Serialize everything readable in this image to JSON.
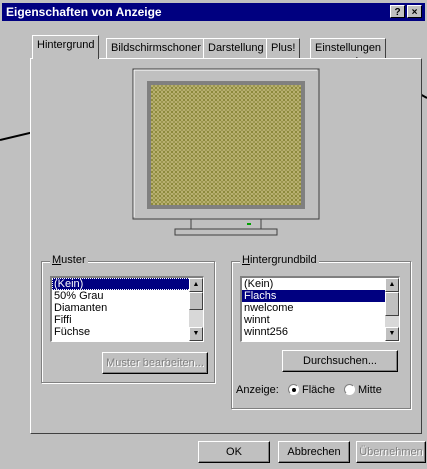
{
  "window": {
    "title": "Eigenschaften von Anzeige",
    "help_button": "?",
    "close_button": "×"
  },
  "tabs": [
    {
      "label": "Hintergrund",
      "active": true
    },
    {
      "label": "Bildschirmschoner",
      "active": false
    },
    {
      "label": "Darstellung",
      "active": false
    },
    {
      "label": "Plus!",
      "active": false
    },
    {
      "label": "Einstellungen",
      "active": false
    }
  ],
  "monitor": {
    "screen_pattern_color": "#a8a050",
    "icon": "monitor-preview"
  },
  "muster": {
    "label": "Muster",
    "items": [
      "(Kein)",
      "50% Grau",
      "Diamanten",
      "Fiffi",
      "Füchse"
    ],
    "selected": "(Kein)",
    "edit_button": "Muster bearbeiten..."
  },
  "hintergrundbild": {
    "label": "Hintergrundbild",
    "items": [
      "(Kein)",
      "Flachs",
      "nwelcome",
      "winnt",
      "winnt256"
    ],
    "selected": "Flachs",
    "browse_button": "Durchsuchen...",
    "anzeige_label": "Anzeige:",
    "options": [
      {
        "label": "Fläche",
        "checked": true
      },
      {
        "label": "Mitte",
        "checked": false
      }
    ]
  },
  "footer": {
    "ok": "OK",
    "cancel": "Abbrechen",
    "apply": "Übernehmen"
  },
  "colors": {
    "title_bar": "#000080",
    "selection": "#000080",
    "face": "#c0c0c0"
  }
}
